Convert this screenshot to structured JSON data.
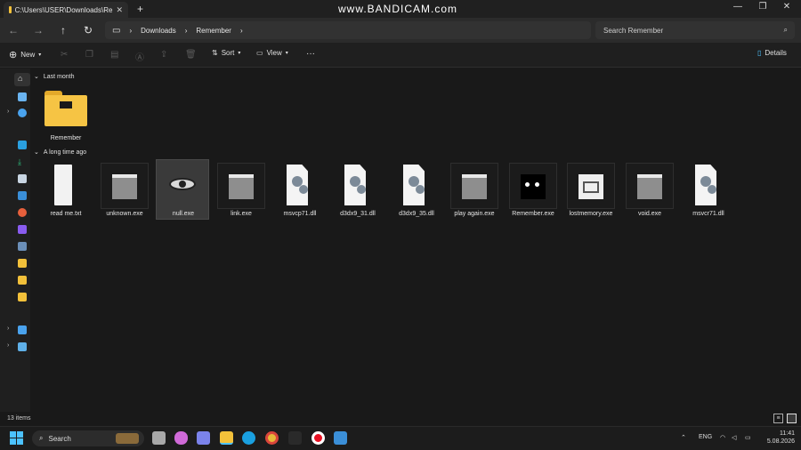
{
  "window": {
    "tab_title": "C:\\Users\\USER\\Downloads\\Re",
    "watermark": "www.BANDICAM.com"
  },
  "address": {
    "crumbs": [
      "Downloads",
      "Remember"
    ]
  },
  "search": {
    "placeholder": "Search Remember"
  },
  "toolbar": {
    "new_label": "New",
    "sort_label": "Sort",
    "view_label": "View",
    "more_label": "···",
    "details_label": "Details"
  },
  "groups": [
    {
      "label": "Last month",
      "items": [
        "Remember"
      ]
    },
    {
      "label": "A long time ago",
      "items": [
        "read me.txt",
        "unknown.exe",
        "null.exe",
        "link.exe",
        "msvcp71.dll",
        "d3dx9_31.dll",
        "d3dx9_35.dll",
        "play again.exe",
        "Remember.exe",
        "lostmemory.exe",
        "void.exe",
        "msvcr71.dll"
      ]
    }
  ],
  "files": [
    {
      "name": "read me.txt",
      "icon": "text-file-icon"
    },
    {
      "name": "unknown.exe",
      "icon": "exe-gray-icon"
    },
    {
      "name": "null.exe",
      "icon": "eye-icon",
      "selected": true
    },
    {
      "name": "link.exe",
      "icon": "exe-gray-icon"
    },
    {
      "name": "msvcp71.dll",
      "icon": "dll-gear-icon"
    },
    {
      "name": "d3dx9_31.dll",
      "icon": "dll-gear-icon"
    },
    {
      "name": "d3dx9_35.dll",
      "icon": "dll-gear-icon"
    },
    {
      "name": "play again.exe",
      "icon": "exe-gray-icon"
    },
    {
      "name": "Remember.exe",
      "icon": "black-eyes-icon"
    },
    {
      "name": "lostmemory.exe",
      "icon": "cup-icon"
    },
    {
      "name": "void.exe",
      "icon": "exe-gray-icon"
    },
    {
      "name": "msvcr71.dll",
      "icon": "dll-gear-icon"
    }
  ],
  "folder": {
    "name": "Remember"
  },
  "status": {
    "item_count": "13 items"
  },
  "taskbar": {
    "search_label": "Search",
    "language": "ENG",
    "time": "11:41",
    "date": "5.08.2026"
  },
  "colors": {
    "folder": "#f3c13a",
    "accent": "#4cc2ff",
    "record": "#e81123"
  }
}
